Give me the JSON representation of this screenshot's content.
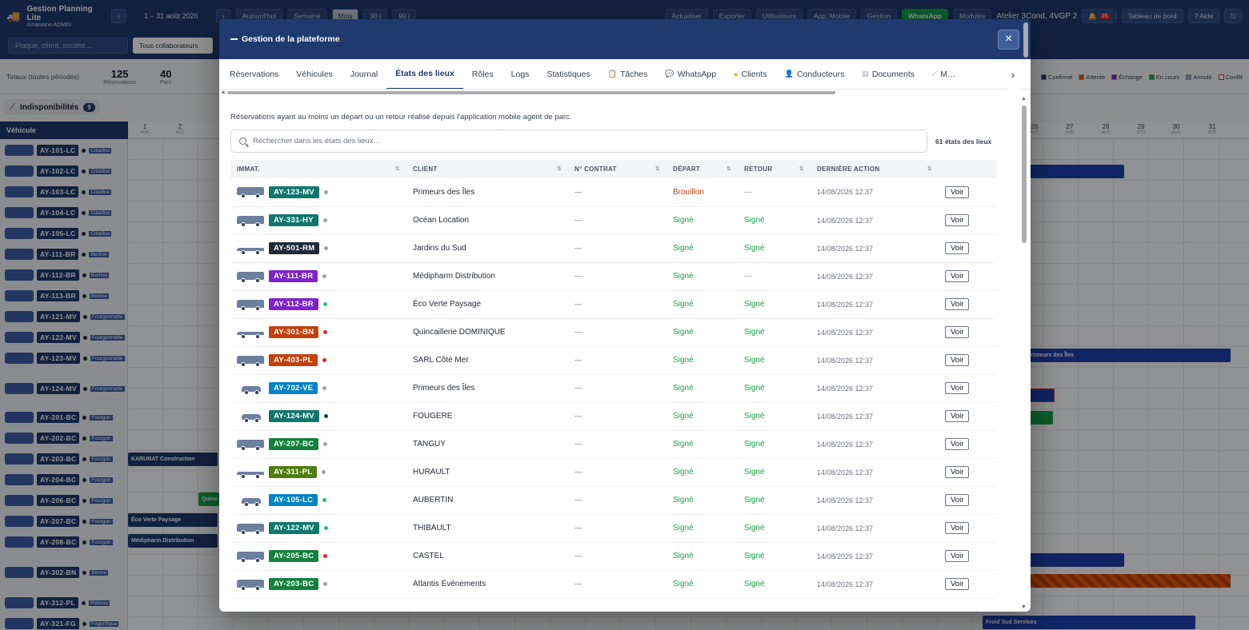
{
  "app": {
    "title": "Gestion Planning Lite",
    "user": "Amandine ADMIN",
    "period": "1 – 31 août 2026",
    "view_buttons": [
      "Aujourd'hui",
      "Semaine",
      "Mois",
      "30 j",
      "90 j"
    ],
    "actions": [
      "Actualiser",
      "Exporter",
      "Utilisateurs",
      "App. Mobile",
      "Gestion",
      "WhatsApp",
      "Modules"
    ],
    "atelier": "Atelier 3Cond. 4VGP 2",
    "alerts_count": "26",
    "dashboard": "Tableau de bord",
    "help": "? Aide",
    "search_placeholder": "Plaque, client, société…",
    "collaborators_select": "Tous collaborateurs",
    "totals_label": "Totaux (toutes périodes)",
    "kpis": [
      {
        "value": "125",
        "label": "Réservations"
      },
      {
        "value": "40",
        "label": "Parc"
      }
    ],
    "legend": [
      "Confirmé",
      "Attente",
      "Échange",
      "En cours",
      "Annulé",
      "Conflit"
    ],
    "unavailability_label": "Indisponibilités",
    "unavailability_count": "9",
    "vehicle_header": "Véhicule",
    "day_month_abbr": "AOÛ",
    "days_left": [
      "1",
      "2"
    ],
    "days_right": [
      "26",
      "27",
      "28",
      "29",
      "30",
      "31"
    ],
    "vehicles": [
      {
        "plate": "AY-101-LC",
        "cat": "Citadine"
      },
      {
        "plate": "AY-102-LC",
        "cat": "Citadine"
      },
      {
        "plate": "AY-103-LC",
        "cat": "Citadine"
      },
      {
        "plate": "AY-104-LC",
        "cat": "Citadine"
      },
      {
        "plate": "AY-105-LC",
        "cat": "Citadine"
      },
      {
        "plate": "AY-111-BR",
        "cat": "Berline"
      },
      {
        "plate": "AY-112-BR",
        "cat": "Berline"
      },
      {
        "plate": "AY-113-BR",
        "cat": "Berline"
      },
      {
        "plate": "AY-121-MV",
        "cat": "Fourgonnette"
      },
      {
        "plate": "AY-122-MV",
        "cat": "Fourgonnette"
      },
      {
        "plate": "AY-123-MV",
        "cat": "Fourgonnette"
      },
      {
        "plate": "AY-124-MV",
        "cat": "Fourgonnette"
      },
      {
        "plate": "AY-201-BC",
        "cat": "Fourgon"
      },
      {
        "plate": "AY-202-BC",
        "cat": "Fourgon"
      },
      {
        "plate": "AY-203-BC",
        "cat": "Fourgon"
      },
      {
        "plate": "AY-204-BC",
        "cat": "Fourgon"
      },
      {
        "plate": "AY-206-BC",
        "cat": "Fourgon"
      },
      {
        "plate": "AY-207-BC",
        "cat": "Fourgon"
      },
      {
        "plate": "AY-208-BC",
        "cat": "Fourgon"
      },
      {
        "plate": "AY-302-BN",
        "cat": "Benne"
      },
      {
        "plate": "AY-312-PL",
        "cat": "Plateau"
      },
      {
        "plate": "AY-321-FG",
        "cat": "Frigorifique"
      }
    ],
    "bars": [
      "KARUBAT Construction",
      "Quinc",
      "Éco Verte Paysage",
      "Médipharm Distribution",
      "Primeurs des Îles",
      "Froid Sud Services"
    ]
  },
  "modal": {
    "title": "Gestion de la plateforme",
    "close_label": "×",
    "tabs": [
      {
        "label": "Réservations",
        "icon": ""
      },
      {
        "label": "Véhicules",
        "icon": ""
      },
      {
        "label": "Journal",
        "icon": ""
      },
      {
        "label": "États des lieux",
        "icon": "",
        "active": true
      },
      {
        "label": "Rôles",
        "icon": ""
      },
      {
        "label": "Logs",
        "icon": ""
      },
      {
        "label": "Statistiques",
        "icon": ""
      },
      {
        "label": "Tâches",
        "icon": "clipboard-icon"
      },
      {
        "label": "WhatsApp",
        "icon": "chat-icon"
      },
      {
        "label": "Clients",
        "icon": "coin-icon"
      },
      {
        "label": "Conducteurs",
        "icon": "user-icon"
      },
      {
        "label": "Documents",
        "icon": "document-icon"
      },
      {
        "label": "M…",
        "icon": "tool-icon"
      }
    ],
    "description": "Réservations ayant au moins un départ ou un retour réalisé depuis l'application mobile agent de parc.",
    "search_placeholder": "Rechercher dans les états des lieux…",
    "result_count": "61 états des lieux",
    "columns": [
      "IMMAT.",
      "CLIENT",
      "N° CONTRAT",
      "DÉPART",
      "RETOUR",
      "DERNIÈRE ACTION",
      ""
    ],
    "voir_label": "Voir",
    "rows": [
      {
        "plate": "AY-123-MV",
        "plate_color": "#0f766e",
        "dot": "#9ca3af",
        "vehicle": "van",
        "client": "Primeurs des Îles",
        "contract": "—",
        "depart": "Brouillon",
        "depart_status": "brouillon",
        "retour": "—",
        "retour_status": "none",
        "last": "14/08/2026 12:37"
      },
      {
        "plate": "AY-331-HY",
        "plate_color": "#0f766e",
        "dot": "#9ca3af",
        "vehicle": "truck",
        "client": "Océan Location",
        "contract": "—",
        "depart": "Signé",
        "depart_status": "signe",
        "retour": "Signé",
        "retour_status": "signe",
        "last": "14/08/2026 12:37"
      },
      {
        "plate": "AY-501-RM",
        "plate_color": "#1f2937",
        "dot": "#9ca3af",
        "vehicle": "plateau",
        "client": "Jardins du Sud",
        "contract": "—",
        "depart": "Signé",
        "depart_status": "signe",
        "retour": "Signé",
        "retour_status": "signe",
        "last": "14/08/2026 12:37"
      },
      {
        "plate": "AY-111-BR",
        "plate_color": "#7e22ce",
        "dot": "#9ca3af",
        "vehicle": "van",
        "client": "Médipharm Distribution",
        "contract": "—",
        "depart": "Signé",
        "depart_status": "signe",
        "retour": "—",
        "retour_status": "none",
        "last": "14/08/2026 12:37"
      },
      {
        "plate": "AY-112-BR",
        "plate_color": "#7e22ce",
        "dot": "#22c55e",
        "vehicle": "van",
        "client": "Éco Verte Paysage",
        "contract": "—",
        "depart": "Signé",
        "depart_status": "signe",
        "retour": "Signé",
        "retour_status": "signe",
        "last": "14/08/2026 12:37"
      },
      {
        "plate": "AY-301-BN",
        "plate_color": "#c2410c",
        "dot": "#dc2626",
        "vehicle": "plateau",
        "client": "Quincaillerie DOMINIQUE",
        "contract": "—",
        "depart": "Signé",
        "depart_status": "signe",
        "retour": "Signé",
        "retour_status": "signe",
        "last": "14/08/2026 12:37"
      },
      {
        "plate": "AY-403-PL",
        "plate_color": "#c2410c",
        "dot": "#dc2626",
        "vehicle": "truck",
        "client": "SARL Côté Mer",
        "contract": "—",
        "depart": "Signé",
        "depart_status": "signe",
        "retour": "Signé",
        "retour_status": "signe",
        "last": "14/08/2026 12:37"
      },
      {
        "plate": "AY-702-VE",
        "plate_color": "#0284c7",
        "dot": "#9ca3af",
        "vehicle": "car",
        "client": "Primeurs des Îles",
        "contract": "—",
        "depart": "Signé",
        "depart_status": "signe",
        "retour": "Signé",
        "retour_status": "signe",
        "last": "14/08/2026 12:37"
      },
      {
        "plate": "AY-124-MV",
        "plate_color": "#0f766e",
        "dot": "#1e3a6e",
        "vehicle": "car",
        "client": "FOUGERE",
        "contract": "—",
        "depart": "Signé",
        "depart_status": "signe",
        "retour": "Signé",
        "retour_status": "signe",
        "last": "14/08/2026 12:37"
      },
      {
        "plate": "AY-207-BC",
        "plate_color": "#15803d",
        "dot": "#9ca3af",
        "vehicle": "truck",
        "client": "TANGUY",
        "contract": "—",
        "depart": "Signé",
        "depart_status": "signe",
        "retour": "Signé",
        "retour_status": "signe",
        "last": "14/08/2026 12:37"
      },
      {
        "plate": "AY-311-PL",
        "plate_color": "#4d7c0f",
        "dot": "#9ca3af",
        "vehicle": "plateau",
        "client": "HURAULT",
        "contract": "—",
        "depart": "Signé",
        "depart_status": "signe",
        "retour": "Signé",
        "retour_status": "signe",
        "last": "14/08/2026 12:37"
      },
      {
        "plate": "AY-105-LC",
        "plate_color": "#0284c7",
        "dot": "#22c55e",
        "vehicle": "car",
        "client": "AUBERTIN",
        "contract": "—",
        "depart": "Signé",
        "depart_status": "signe",
        "retour": "Signé",
        "retour_status": "signe",
        "last": "14/08/2026 12:37"
      },
      {
        "plate": "AY-122-MV",
        "plate_color": "#0f766e",
        "dot": "#22c55e",
        "vehicle": "van",
        "client": "THIBAULT",
        "contract": "—",
        "depart": "Signé",
        "depart_status": "signe",
        "retour": "Signé",
        "retour_status": "signe",
        "last": "14/08/2026 12:37"
      },
      {
        "plate": "AY-205-BC",
        "plate_color": "#15803d",
        "dot": "#dc2626",
        "vehicle": "truck",
        "client": "CASTEL",
        "contract": "—",
        "depart": "Signé",
        "depart_status": "signe",
        "retour": "Signé",
        "retour_status": "signe",
        "last": "14/08/2026 12:37"
      },
      {
        "plate": "AY-203-BC",
        "plate_color": "#15803d",
        "dot": "#9ca3af",
        "vehicle": "truck",
        "client": "Atlantis Événements",
        "contract": "—",
        "depart": "Signé",
        "depart_status": "signe",
        "retour": "Signé",
        "retour_status": "signe",
        "last": "14/08/2026 12:37"
      }
    ]
  }
}
